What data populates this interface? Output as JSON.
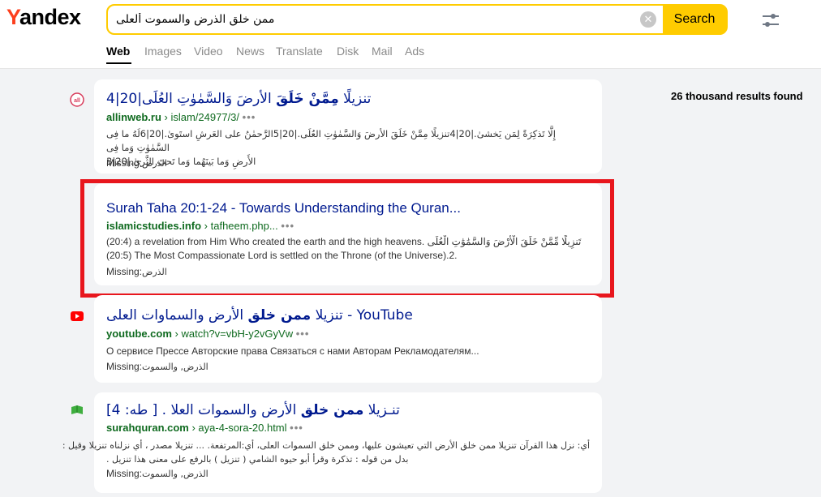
{
  "header": {
    "logo_first": "Y",
    "logo_rest": "andex",
    "search_value": "ممن خلق الذرض والسموت ألعلى",
    "search_button": "Search",
    "clear_glyph": "✕"
  },
  "tabs": [
    {
      "label": "Web",
      "active": true
    },
    {
      "label": "Images"
    },
    {
      "label": "Video"
    },
    {
      "label": "News"
    },
    {
      "label": "Translate"
    },
    {
      "label": "Disk"
    },
    {
      "label": "Mail"
    },
    {
      "label": "Ads"
    }
  ],
  "results_count": "26 thousand results found",
  "results": [
    {
      "title_pre": "تنزيلًا ",
      "title_bold": "مِمَّنْ خَلَقَ",
      "title_post": " الأرضَ وَالسَّمٰوٰتِ العُلَى|20|4",
      "host": "allinweb.ru",
      "path": "› islam/24977/3/",
      "dots": "•••",
      "snippet_line1": "إِلَّا تَذكِرَةً لِمَن يَخشىٰ.|20|4تنزيلًا مِمَّنْ خَلَقَ الأرضَ وَالسَّمٰوٰتِ العُلَى.|20|5الرَّحمٰنُ على العَرشِ استَوىٰ.|20|6لَهُ ما فِى السَّمٰوٰتِ وَما فِى",
      "snippet_line2": "الأَرضِ وَما بَينَهُما وَما تَحتَ الثَّرىٰ.|20|3",
      "missing_label": "Missing:",
      "missing_words": "الذرض"
    },
    {
      "title": "Surah Taha 20:1-24 - Towards Understanding the Quran...",
      "host": "islamicstudies.info",
      "path": "› tafheem.php...",
      "dots": "•••",
      "snippet_line1": "(20:4) a revelation from Him Who created the earth and the high heavens. تَنزِيلًا مِّمَّنْ خَلَقَ الْأَرْضَ وَالسَّمَٰوَٰتِ الْعُلَى",
      "snippet_line2": "(20:5) The Most Compassionate Lord is settled on the Throne (of the Universe).2.",
      "missing_label": "Missing:",
      "missing_words": "الذرض"
    },
    {
      "title_pre": "تنزيلا ",
      "title_bold": "ممن خلق",
      "title_post": " الأرض والسماوات العلى - YouTube",
      "host": "youtube.com",
      "path": "› watch?v=vbH-y2vGyVw",
      "dots": "•••",
      "snippet_line1": "О сервисе Прессе Авторские права Связаться с нами Авторам Рекламодателям...",
      "missing_label": "Missing:",
      "missing_words": "الذرض, والسموت"
    },
    {
      "title_pre": "تنـزيلا ",
      "title_bold": "ممن خلق",
      "title_post": " الأرض والسموات العلا . [ طه: 4]",
      "host": "surahquran.com",
      "path": "› aya-4-sora-20.html",
      "dots": "•••",
      "snippet_line1": "أي: نزل هذا القرآن تنزيلا ممن خلق الأرض التي تعيشون عليها، وممن خلق السموات العلى، أي:المرتفعة. ... تنزيلا مصدر ، أي نزلناه تنزيلا وقيل :",
      "snippet_line2": "بدل من قوله : تذكرة وقرأ أبو حيوه الشامي ( تنزيل ) بالرفع على معنى هذا تنزيل .",
      "missing_label": "Missing:",
      "missing_words": "الذرض, والسموت"
    }
  ],
  "colors": {
    "accent": "#ffcc00",
    "link": "#001a8f",
    "url": "#0f6a1f",
    "highlight": "#e8161d",
    "logo_y": "#fc3f1d"
  },
  "icons": [
    "settings-sliders-icon",
    "clear-icon",
    "allinweb-favicon",
    "youtube-favicon",
    "surahquran-favicon"
  ]
}
